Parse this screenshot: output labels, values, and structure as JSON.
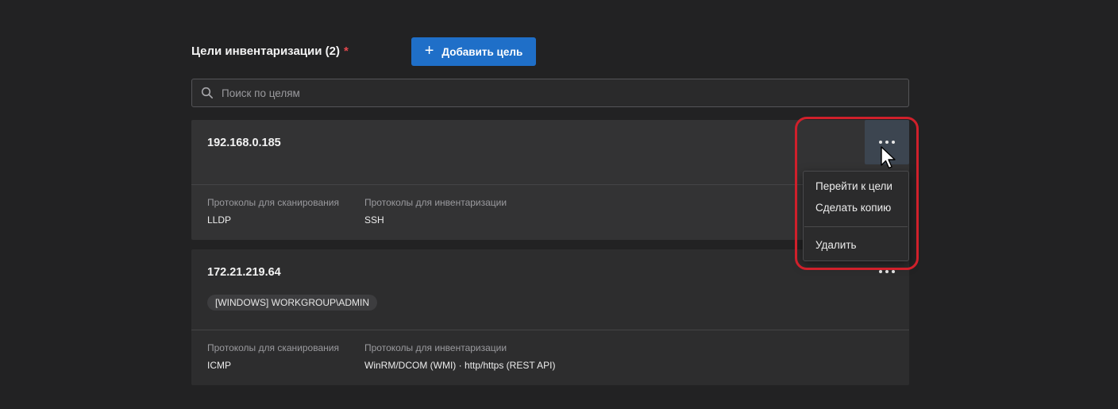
{
  "header": {
    "title": "Цели инвентаризации (2)",
    "required_mark": "*",
    "add_button_label": "Добавить цель",
    "add_button_icon": "plus-icon"
  },
  "search": {
    "placeholder": "Поиск по целям",
    "value": "",
    "icon": "search-icon"
  },
  "targets": [
    {
      "address": "192.168.0.185",
      "scan_protocols_label": "Протоколы для сканирования",
      "scan_protocols_value": "LLDP",
      "inventory_protocols_label": "Протоколы для инвентаризации",
      "inventory_protocols_value": "SSH"
    },
    {
      "address": "172.21.219.64",
      "credential_tag": "[WINDOWS] WORKGROUP\\ADMIN",
      "scan_protocols_label": "Протоколы для сканирования",
      "scan_protocols_value": "ICMP",
      "inventory_protocols_label": "Протоколы для инвентаризации",
      "inventory_protocols_value": "WinRM/DCOM (WMI) · http/https (REST API)"
    }
  ],
  "context_menu": {
    "items": [
      "Перейти к цели",
      "Сделать копию",
      "Удалить"
    ]
  },
  "colors": {
    "background": "#222223",
    "accent": "#1f6fc8",
    "required": "#e5484d",
    "highlight": "#d0202b"
  }
}
